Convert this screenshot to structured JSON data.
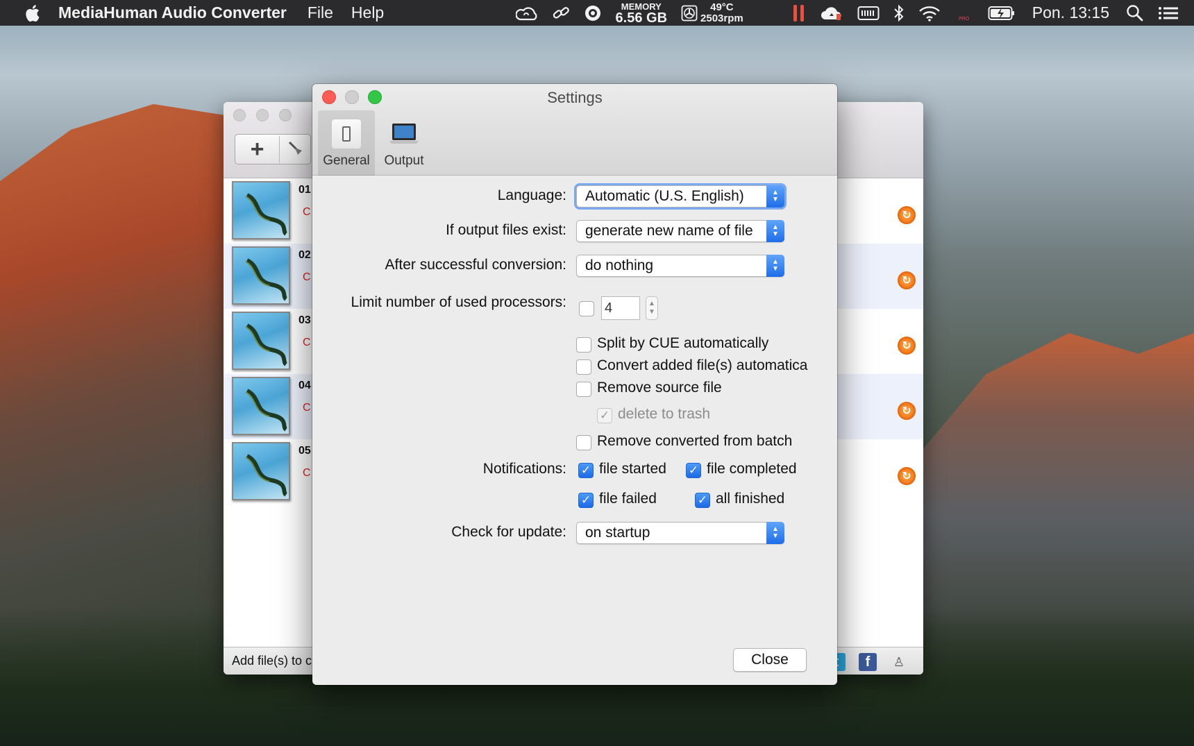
{
  "menubar": {
    "app_name": "MediaHuman Audio Converter",
    "menus": [
      "File",
      "Help"
    ],
    "memory_label": "MEMORY",
    "memory_value": "6.56 GB",
    "temperature": "49°C",
    "fan_speed": "2503rpm",
    "flag_badge": "PRO",
    "clock": "Pon. 13:15",
    "icons": [
      "apple-icon",
      "creative-cloud-icon",
      "link-icon",
      "vpn-icon",
      "memory-icon",
      "fan-icon",
      "pause-icon",
      "cloud-icon",
      "battery-meter-icon",
      "bluetooth-icon",
      "wifi-icon",
      "language-flag-icon",
      "battery-icon",
      "spotlight-icon",
      "notification-center-icon"
    ]
  },
  "main_window": {
    "tracks": [
      {
        "num": "01",
        "sub": "C"
      },
      {
        "num": "02",
        "sub": "C"
      },
      {
        "num": "03",
        "sub": "C"
      },
      {
        "num": "04",
        "sub": "C"
      },
      {
        "num": "05",
        "sub": "C"
      }
    ],
    "status_text": "Add file(s) to c"
  },
  "settings": {
    "title": "Settings",
    "tabs": [
      {
        "label": "General",
        "selected": true
      },
      {
        "label": "Output",
        "selected": false
      }
    ],
    "language": {
      "label": "Language:",
      "value": "Automatic (U.S. English)"
    },
    "output_exist": {
      "label": "If output files exist:",
      "value": "generate new name of file"
    },
    "after_conversion": {
      "label": "After successful conversion:",
      "value": "do nothing"
    },
    "processors": {
      "label": "Limit number of used processors:",
      "checked": false,
      "value": "4"
    },
    "options": {
      "split_cue": {
        "label": "Split by CUE automatically",
        "checked": false
      },
      "convert_added": {
        "label": "Convert added file(s) automatica",
        "checked": false
      },
      "remove_source": {
        "label": "Remove source file",
        "checked": false
      },
      "delete_trash": {
        "label": "delete to trash",
        "checked": true,
        "disabled": true
      },
      "remove_converted": {
        "label": "Remove converted from batch",
        "checked": false
      }
    },
    "notifications": {
      "label": "Notifications:",
      "file_started": {
        "label": "file started",
        "checked": true
      },
      "file_completed": {
        "label": "file completed",
        "checked": true
      },
      "file_failed": {
        "label": "file failed",
        "checked": true
      },
      "all_finished": {
        "label": "all finished",
        "checked": true
      }
    },
    "check_update": {
      "label": "Check for update:",
      "value": "on startup"
    },
    "close_label": "Close"
  },
  "colors": {
    "accent": "#1d6ae6",
    "status_orange": "#f2761a",
    "error_red": "#dd2222"
  }
}
